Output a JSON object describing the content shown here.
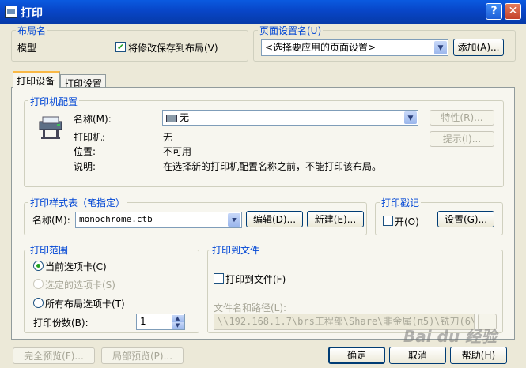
{
  "window": {
    "title": "打印",
    "help_glyph": "?",
    "close_glyph": "✕"
  },
  "layout_name": {
    "legend": "布局名",
    "value": "模型",
    "save_changes_label": "将修改保存到布局(V)",
    "save_changes_checked": true
  },
  "page_setup": {
    "legend": "页面设置名(U)",
    "select_value": "<选择要应用的页面设置>",
    "add_button": "添加(A)..."
  },
  "tabs": {
    "device": "打印设备",
    "settings": "打印设置"
  },
  "printer_config": {
    "legend": "打印机配置",
    "name_label": "名称(M):",
    "name_value": "无",
    "printer_label": "打印机:",
    "printer_value": "无",
    "location_label": "位置:",
    "location_value": "不可用",
    "description_label": "说明:",
    "description_value": "在选择新的打印机配置名称之前，不能打印该布局。",
    "properties_button": "特性(R)...",
    "hints_button": "提示(I)..."
  },
  "plot_style": {
    "legend": "打印样式表（笔指定）",
    "name_label": "名称(M):",
    "name_value": "monochrome.ctb",
    "edit_button": "编辑(D)...",
    "new_button": "新建(E)..."
  },
  "plot_stamp": {
    "legend": "打印戳记",
    "on_label": "开(O)",
    "on_checked": false,
    "settings_button": "设置(G)..."
  },
  "plot_range": {
    "legend": "打印范围",
    "current_tab": "当前选项卡(C)",
    "selected_tabs": "选定的选项卡(S)",
    "all_layout_tabs": "所有布局选项卡(T)",
    "selected": "current_tab",
    "copies_label": "打印份数(B):",
    "copies_value": "1"
  },
  "plot_to_file": {
    "legend": "打印到文件",
    "checkbox_label": "打印到文件(F)",
    "checked": false,
    "path_label": "文件名和路径(L):",
    "path_value": "\\\\192.168.1.7\\brs工程部\\Share\\非金属(π5)\\铣刀(6\\"
  },
  "footer": {
    "full_preview": "完全预览(F)...",
    "partial_preview": "局部预览(P)...",
    "ok": "确定",
    "cancel": "取消",
    "help": "帮助(H)"
  },
  "watermark": "Bai du 经验",
  "icons": {
    "title": "printer-app-icon",
    "plotter": "plotter-icon",
    "printer_small": "printer-small-icon",
    "dropdown": "chevron-down-icon"
  }
}
